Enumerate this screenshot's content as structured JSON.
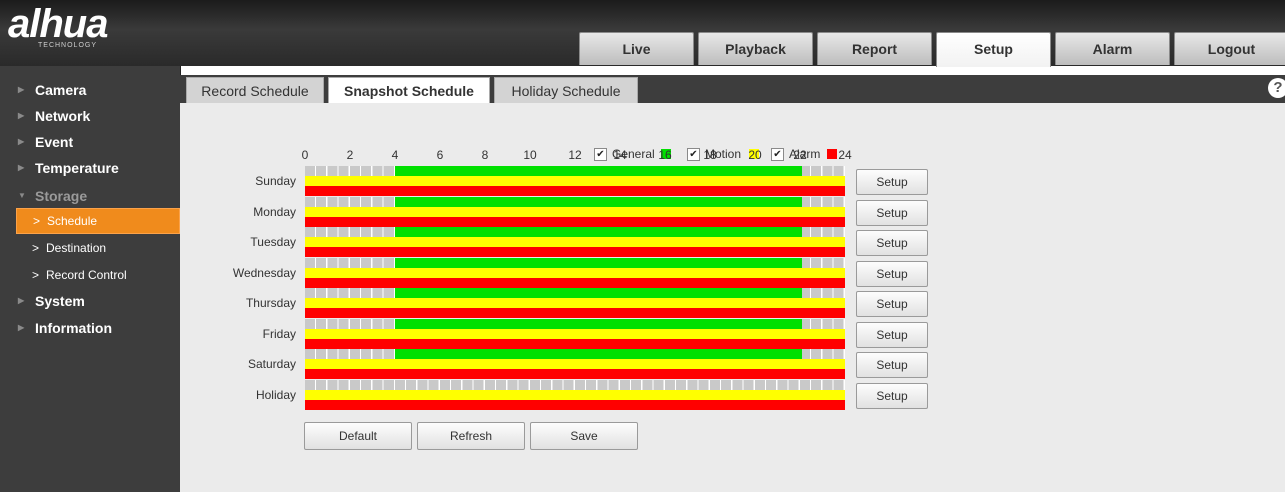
{
  "brand": {
    "logo_text": "alhua",
    "logo_sub": "TECHNOLOGY"
  },
  "nav": {
    "tabs": [
      {
        "label": "Live"
      },
      {
        "label": "Playback"
      },
      {
        "label": "Report"
      },
      {
        "label": "Setup",
        "active": true
      },
      {
        "label": "Alarm"
      },
      {
        "label": "Logout"
      }
    ]
  },
  "sidebar": {
    "items": [
      {
        "label": "Camera"
      },
      {
        "label": "Network"
      },
      {
        "label": "Event"
      },
      {
        "label": "Temperature"
      },
      {
        "label": "Storage",
        "expanded": true
      },
      {
        "label": "System"
      },
      {
        "label": "Information"
      }
    ],
    "storage_sub": [
      {
        "label": "Schedule",
        "active": true
      },
      {
        "label": "Destination"
      },
      {
        "label": "Record Control"
      }
    ]
  },
  "content_tabs": [
    {
      "label": "Record Schedule"
    },
    {
      "label": "Snapshot Schedule",
      "active": true
    },
    {
      "label": "Holiday Schedule"
    }
  ],
  "help_icon": "?",
  "legend": [
    {
      "label": "General",
      "checked": true,
      "color": "#00e000"
    },
    {
      "label": "Motion",
      "checked": true,
      "color": "#ffff00"
    },
    {
      "label": "Alarm",
      "checked": true,
      "color": "#ff0000"
    }
  ],
  "colors": {
    "general": "#00e000",
    "motion": "#ffff00",
    "alarm": "#ff0000",
    "empty": "#c9c9c9",
    "accent": "#f08b1c"
  },
  "hour_labels": [
    "0",
    "2",
    "4",
    "6",
    "8",
    "10",
    "12",
    "14",
    "16",
    "18",
    "20",
    "22",
    "24"
  ],
  "schedule": {
    "days": [
      {
        "label": "Sunday",
        "general": [
          4,
          22.1
        ],
        "motion": [
          0,
          24
        ],
        "alarm": [
          0,
          24
        ]
      },
      {
        "label": "Monday",
        "general": [
          4,
          22.1
        ],
        "motion": [
          0,
          24
        ],
        "alarm": [
          0,
          24
        ]
      },
      {
        "label": "Tuesday",
        "general": [
          4,
          22.1
        ],
        "motion": [
          0,
          24
        ],
        "alarm": [
          0,
          24
        ]
      },
      {
        "label": "Wednesday",
        "general": [
          4,
          22.1
        ],
        "motion": [
          0,
          24
        ],
        "alarm": [
          0,
          24
        ]
      },
      {
        "label": "Thursday",
        "general": [
          4,
          22.1
        ],
        "motion": [
          0,
          24
        ],
        "alarm": [
          0,
          24
        ]
      },
      {
        "label": "Friday",
        "general": [
          4,
          22.1
        ],
        "motion": [
          0,
          24
        ],
        "alarm": [
          0,
          24
        ]
      },
      {
        "label": "Saturday",
        "general": [
          4,
          22.1
        ],
        "motion": [
          0,
          24
        ],
        "alarm": [
          0,
          24
        ]
      },
      {
        "label": "Holiday",
        "general": null,
        "motion": [
          0,
          24
        ],
        "alarm": [
          0,
          24
        ]
      }
    ]
  },
  "setup_label": "Setup",
  "buttons": {
    "default": "Default",
    "refresh": "Refresh",
    "save": "Save"
  }
}
